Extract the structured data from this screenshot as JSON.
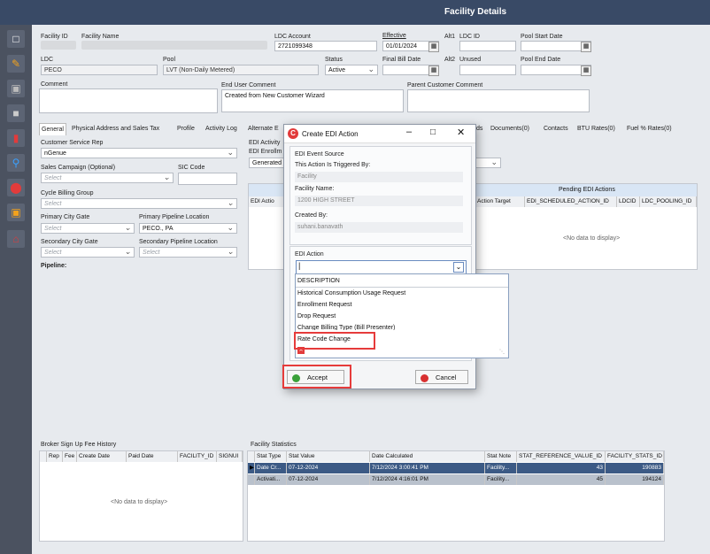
{
  "window": {
    "title": "Facility Details"
  },
  "toolbar_icons": [
    "new-document-icon",
    "edit-pencil-icon",
    "save-disk-icon",
    "eraser-icon",
    "delete-trash-icon",
    "search-zoom-icon",
    "toggle-icon",
    "org-chart-icon",
    "home-network-icon"
  ],
  "header": {
    "facility_id_label": "Facility ID",
    "facility_name_label": "Facility Name",
    "ldc_account_label": "LDC Account",
    "ldc_account_value": "2721099348",
    "effective_label": "Effective",
    "effective_value": "01/01/2024",
    "alt1_label": "Alt1",
    "ldc_id_label": "LDC ID",
    "pool_start_label": "Pool Start Date",
    "ldc_label": "LDC",
    "ldc_value": "PECO",
    "pool_label": "Pool",
    "pool_value": "LVT (Non-Daily Metered)",
    "status_label": "Status",
    "status_value": "Active",
    "final_bill_label": "Final Bill Date",
    "alt2_label": "Alt2",
    "unused_label": "Unused",
    "pool_end_label": "Pool End Date",
    "comment_label": "Comment",
    "end_user_comment_label": "End User Comment",
    "end_user_comment_value": "Created from New Customer Wizard",
    "parent_comment_label": "Parent Customer Comment"
  },
  "tabs": [
    "General",
    "Physical Address and Sales Tax",
    "Profile",
    "Activity Log",
    "Alternate E",
    "ds",
    "Documents(0)",
    "Contacts",
    "BTU Rates(0)",
    "Fuel % Rates(0)"
  ],
  "general": {
    "csr_label": "Customer Service Rep",
    "csr_value": "nGenue",
    "sales_campaign_label": "Sales Campaign (Optional)",
    "sales_campaign_ph": "Select",
    "sic_label": "SIC Code",
    "cycle_label": "Cycle Billing Group",
    "cycle_ph": "Select",
    "pcg_label": "Primary City Gate",
    "pcg_ph": "Select",
    "ppl_label": "Primary Pipeline Location",
    "ppl_value": "PECO., PA",
    "scg_label": "Secondary City Gate",
    "scg_ph": "Select",
    "spl_label": "Secondary Pipeline Location",
    "spl_ph": "Select",
    "pipeline_label": "Pipeline:"
  },
  "edi": {
    "activity_label": "EDI Activity",
    "enrollment_label": "EDI Enrollm",
    "generated_value": "Generated",
    "pending_header": "Pending EDI Actions",
    "columns": [
      "EDI Actio",
      "Action Target",
      "EDI_SCHEDULED_ACTION_ID",
      "LDCID",
      "LDC_POOLING_ID"
    ],
    "no_data": "<No data to display>"
  },
  "dialog": {
    "title": "Create EDI Action",
    "event_source_label": "EDI Event Source",
    "triggered_label": "This Action Is Triggered By:",
    "triggered_value": "Facility",
    "facility_name_label": "Facility Name:",
    "facility_name_value": "1200 HIGH STREET",
    "created_by_label": "Created By:",
    "created_by_value": "suhani.banavath",
    "edi_action_label": "EDI Action",
    "options": [
      "DESCRIPTION",
      "Historical Consumption Usage Request",
      "Enrollment Request",
      "Drop Request",
      "Change Billing Type (Bill Presenter)",
      "Rate Code Change"
    ],
    "accept_label": "Accept",
    "cancel_label": "Cancel"
  },
  "broker": {
    "title": "Broker Sign Up Fee History",
    "columns": [
      "Rep",
      "Fee",
      "Create Date",
      "Paid Date",
      "FACILITY_ID",
      "SIGNUI"
    ],
    "no_data": "<No data to display>"
  },
  "stats": {
    "title": "Facility Statistics",
    "columns": [
      "Stat Type",
      "Stat Value",
      "Date Calculated",
      "Stat Note",
      "STAT_REFERENCE_VALUE_ID",
      "FACILITY_STATS_ID"
    ],
    "rows": [
      [
        "Date Cr...",
        "07-12-2024",
        "7/12/2024 3:00:41 PM",
        "Facility...",
        "43",
        "190883"
      ],
      [
        "Activati...",
        "07-12-2024",
        "7/12/2024 4:16:01 PM",
        "Facility...",
        "45",
        "194124"
      ]
    ]
  }
}
